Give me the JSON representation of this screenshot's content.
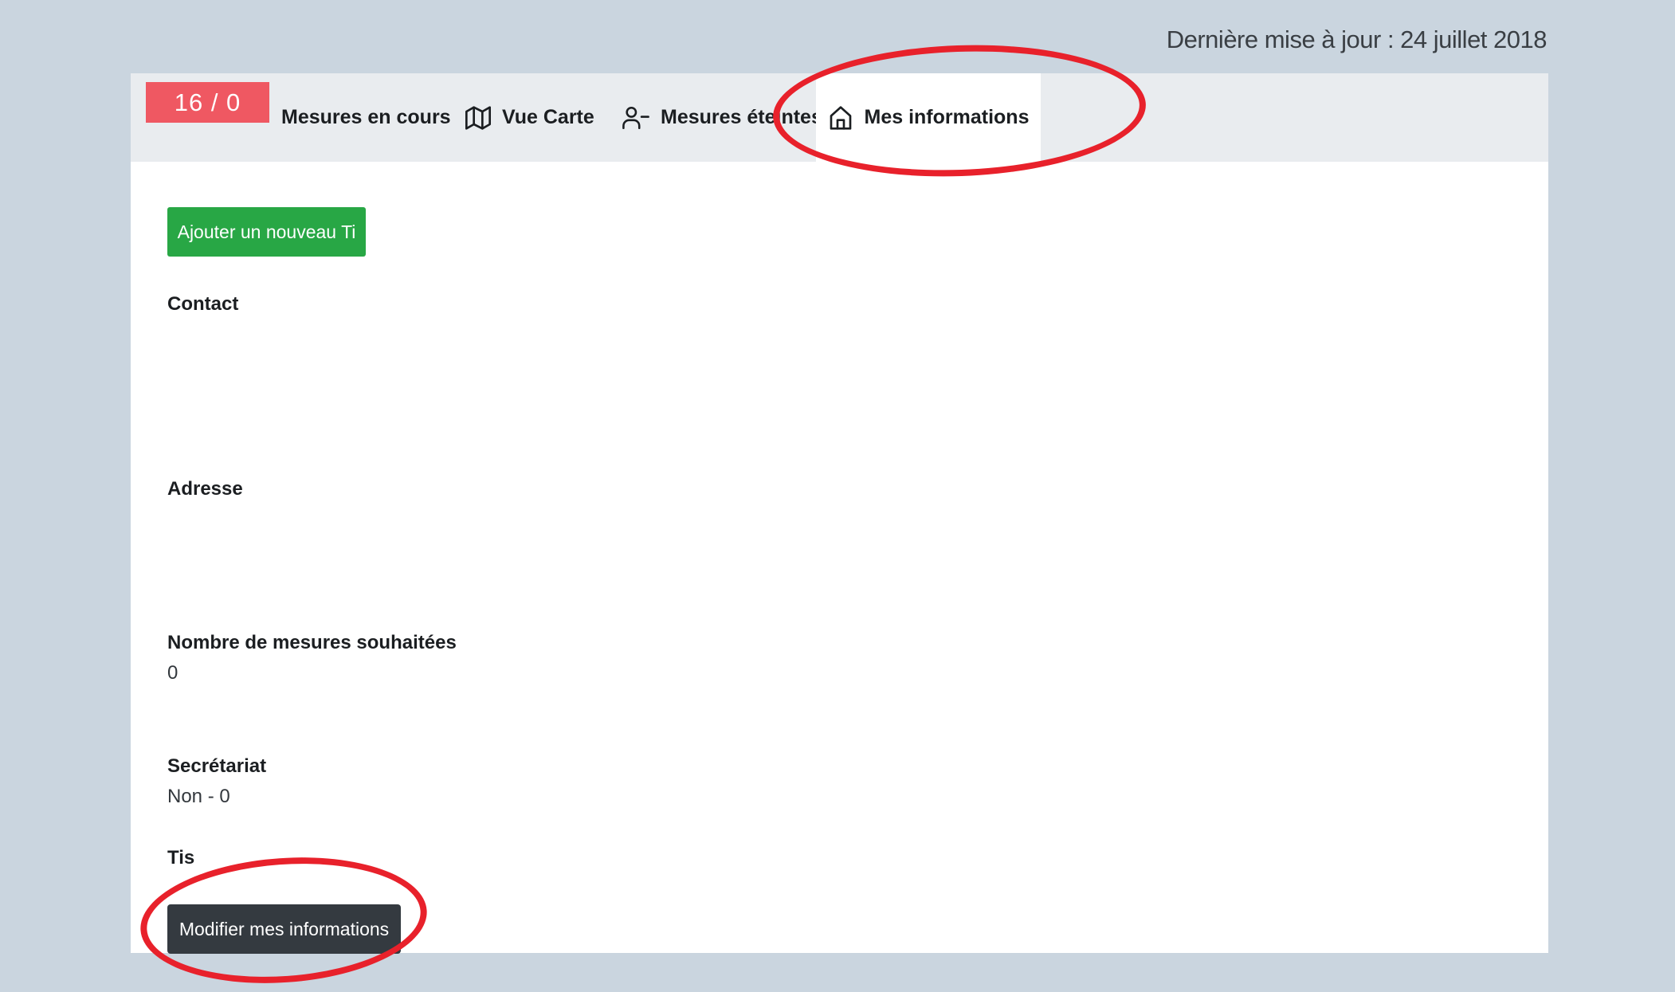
{
  "header": {
    "last_update": "Dernière mise à jour : 24 juillet 2018"
  },
  "nav": {
    "counter": "16 / 0",
    "counter_color": "#ef5862",
    "tabs": [
      {
        "label": "Mesures en cours",
        "icon": null
      },
      {
        "label": "Vue Carte",
        "icon": "map-icon"
      },
      {
        "label": "Mesures éteintes",
        "icon": "user-minus-icon"
      },
      {
        "label": "Mes informations",
        "icon": "home-icon",
        "active": true
      }
    ]
  },
  "main": {
    "add_button_label": "Ajouter un nouveau Ti",
    "add_button_color": "#28a745",
    "fields": {
      "contact": {
        "label": "Contact",
        "value": ""
      },
      "adresse": {
        "label": "Adresse",
        "value": ""
      },
      "nombre": {
        "label": "Nombre de mesures souhaitées",
        "value": "0"
      },
      "secretariat": {
        "label": "Secrétariat",
        "value": "Non - 0"
      },
      "tis": {
        "label": "Tis",
        "value": ""
      }
    },
    "edit_button_label": "Modifier mes informations"
  },
  "annotations": {
    "color": "#e8212b"
  }
}
